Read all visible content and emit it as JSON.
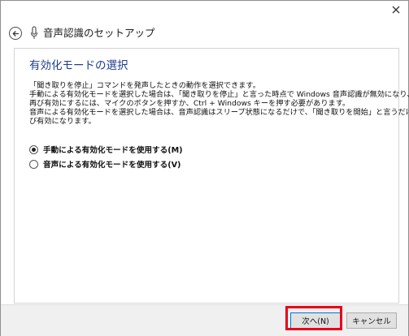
{
  "header": {
    "title": "音声認識のセットアップ"
  },
  "page": {
    "heading": "有効化モードの選択",
    "description": [
      "「聞き取りを停止」コマンドを発声したときの動作を選択できます。",
      "手動による有効化モードを選択した場合は、「聞き取りを停止」と言った時点で Windows 音声認識が無効になり、",
      "再び有効にするには、マイクのボタンを押すか、Ctrl + Windows キーを押す必要があります。",
      "音声による有効化モードを選択した場合は、音声認識はスリープ状態になるだけで、「聞き取りを開始」と言うだけで再",
      "び有効になります。"
    ],
    "options": [
      {
        "label": "手動による有効化モードを使用する(M)",
        "selected": true
      },
      {
        "label": "音声による有効化モードを使用する(V)",
        "selected": false
      }
    ]
  },
  "footer": {
    "next_label": "次へ(N)",
    "cancel_label": "キャンセル",
    "highlight_color": "#e8001c"
  },
  "icons": {
    "close": "close-icon",
    "back": "back-arrow-icon",
    "mic": "microphone-icon"
  }
}
